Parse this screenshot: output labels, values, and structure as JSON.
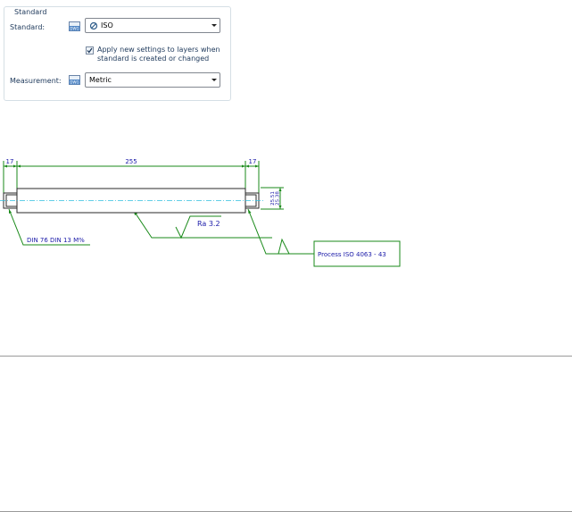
{
  "standard_group": {
    "legend": "Standard",
    "standard_label": "Standard:",
    "standard_value": "ISO",
    "apply_line1": "Apply new settings to layers when",
    "apply_line2": "standard is created or changed",
    "apply_checked": true,
    "measurement_label": "Measurement:",
    "measurement_value": "Metric",
    "dwg_icon_text": "DWG"
  },
  "drawing": {
    "dim_left": "17",
    "dim_middle": "255",
    "dim_right": "17",
    "dim_vertical_1": "25.51",
    "dim_vertical_2": "25.38",
    "roughness": "Ra 3.2",
    "left_leader": "DIN 76 DIN 13 M%",
    "process_note": "Process ISO 4063 - 43"
  },
  "colors": {
    "dimension": "#1a8a1a",
    "text": "#1a1aa8",
    "shaft_edge": "#2a2a2a",
    "centerline": "#30c0e0"
  }
}
